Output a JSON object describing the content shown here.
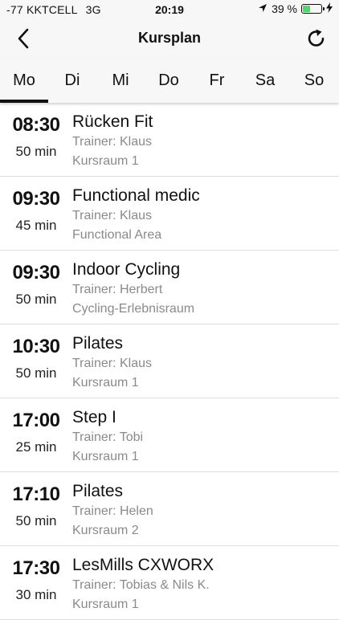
{
  "status_bar": {
    "signal": "-77",
    "carrier": "KKTCELL",
    "network": "3G",
    "time": "20:19",
    "battery_text": "39 %",
    "battery_level_percent": 39,
    "battery_color": "#4cd964",
    "icons": [
      "location-arrow-icon",
      "battery-icon",
      "charging-bolt-icon"
    ]
  },
  "nav": {
    "title": "Kursplan",
    "back_icon": "chevron-left-icon",
    "refresh_icon": "refresh-icon"
  },
  "days": [
    {
      "label": "Mo",
      "active": true
    },
    {
      "label": "Di",
      "active": false
    },
    {
      "label": "Mi",
      "active": false
    },
    {
      "label": "Do",
      "active": false
    },
    {
      "label": "Fr",
      "active": false
    },
    {
      "label": "Sa",
      "active": false
    },
    {
      "label": "So",
      "active": false
    }
  ],
  "courses": [
    {
      "time": "08:30",
      "duration": "50 min",
      "name": "Rücken Fit",
      "trainer": "Trainer: Klaus",
      "room": "Kursraum 1"
    },
    {
      "time": "09:30",
      "duration": "45 min",
      "name": "Functional medic",
      "trainer": "Trainer: Klaus",
      "room": "Functional Area"
    },
    {
      "time": "09:30",
      "duration": "50 min",
      "name": "Indoor Cycling",
      "trainer": "Trainer: Herbert",
      "room": "Cycling-Erlebnisraum"
    },
    {
      "time": "10:30",
      "duration": "50 min",
      "name": "Pilates",
      "trainer": "Trainer: Klaus",
      "room": "Kursraum 1"
    },
    {
      "time": "17:00",
      "duration": "25 min",
      "name": "Step I",
      "trainer": "Trainer: Tobi",
      "room": "Kursraum 1"
    },
    {
      "time": "17:10",
      "duration": "50 min",
      "name": "Pilates",
      "trainer": "Trainer: Helen",
      "room": "Kursraum 2"
    },
    {
      "time": "17:30",
      "duration": "30 min",
      "name": "LesMills CXWORX",
      "trainer": "Trainer: Tobias & Nils K.",
      "room": "Kursraum 1"
    }
  ]
}
